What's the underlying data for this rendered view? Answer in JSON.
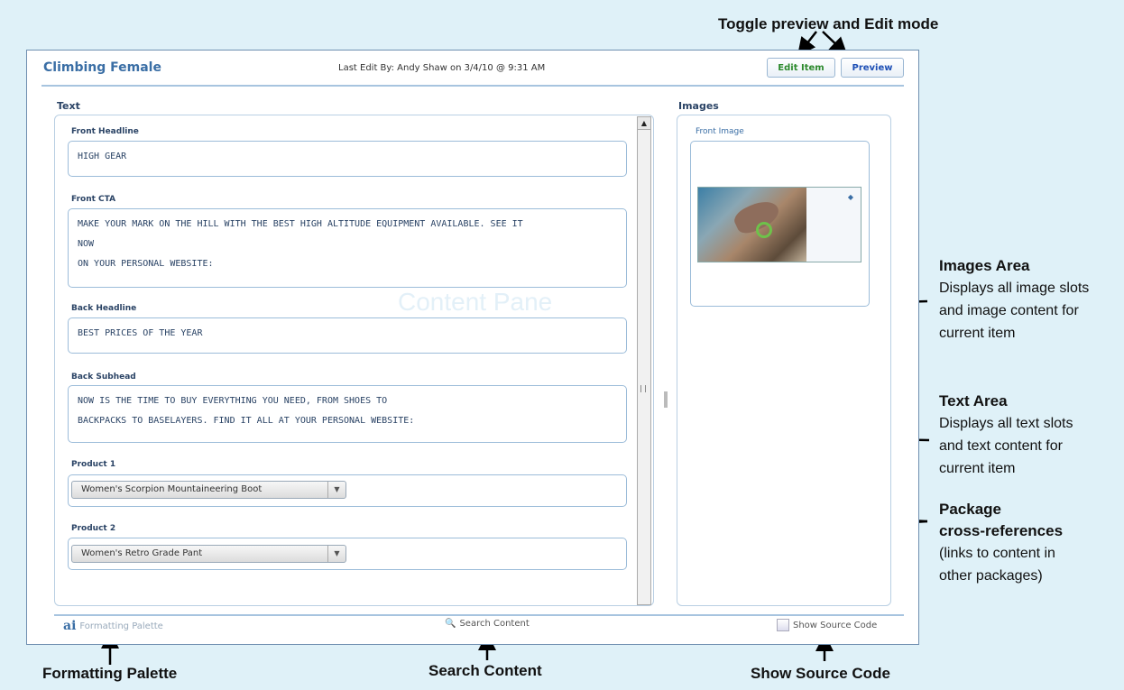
{
  "callouts": {
    "toggle": "Toggle preview and Edit mode",
    "images_title": "Images Area",
    "images_desc": [
      "Displays all image slots",
      "and image content for",
      "current item"
    ],
    "text_title": "Text Area",
    "text_desc": [
      "Displays all text slots",
      "and text content for",
      "current item"
    ],
    "package_title": [
      "Package",
      "cross-references"
    ],
    "package_desc": [
      "(links to content in",
      "other packages)"
    ],
    "formatting": "Formatting Palette",
    "search": "Search Content",
    "source": "Show Source Code"
  },
  "header": {
    "title": "Climbing Female",
    "last_edit": "Last Edit By: Andy Shaw on 3/4/10 @ 9:31 AM",
    "edit_button": "Edit Item",
    "preview_button": "Preview"
  },
  "text_section": {
    "label": "Text",
    "watermark": "Content Pane",
    "fields": {
      "front_headline": {
        "label": "Front Headline",
        "lines": [
          "HIGH GEAR"
        ]
      },
      "front_cta": {
        "label": "Front CTA",
        "lines": [
          "MAKE YOUR MARK ON THE HILL WITH THE BEST HIGH ALTITUDE EQUIPMENT AVAILABLE. SEE IT",
          "NOW",
          "ON YOUR PERSONAL WEBSITE:"
        ]
      },
      "back_headline": {
        "label": "Back Headline",
        "lines": [
          "BEST PRICES OF THE YEAR"
        ]
      },
      "back_subhead": {
        "label": "Back Subhead",
        "lines": [
          "NOW IS THE TIME TO BUY EVERYTHING YOU NEED, FROM SHOES TO",
          "BACKPACKS TO BASELAYERS. FIND IT ALL AT YOUR PERSONAL WEBSITE:"
        ]
      },
      "product1": {
        "label": "Product 1",
        "value": "Women's Scorpion Mountaineering Boot"
      },
      "product2": {
        "label": "Product 2",
        "value": "Women's Retro Grade Pant"
      }
    }
  },
  "images_section": {
    "label": "Images",
    "front_image_label": "Front Image"
  },
  "footer": {
    "formatting": "Formatting Palette",
    "search": "Search Content",
    "source": "Show Source Code"
  }
}
